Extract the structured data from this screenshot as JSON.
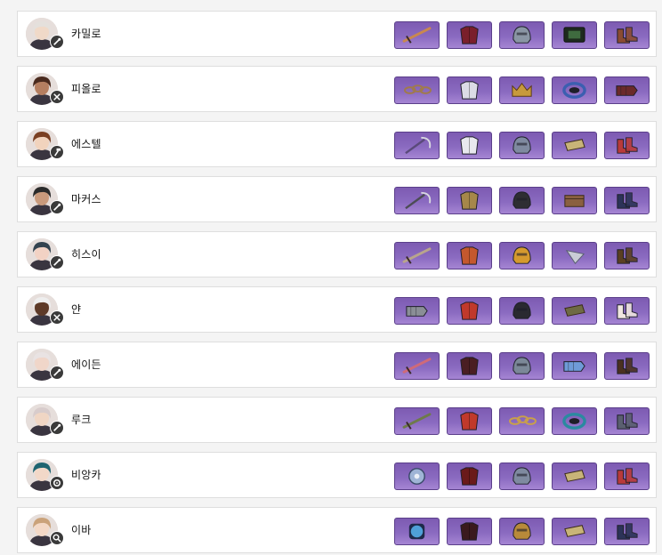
{
  "characters": [
    {
      "name": "카밀로",
      "role_icon": "wrench-icon",
      "hair": "#e4e0dc",
      "skin": "#f0d9c8",
      "items": [
        {
          "icon": "sword-icon",
          "color": "#c9884f"
        },
        {
          "icon": "armor-icon",
          "color": "#7a1f2b"
        },
        {
          "icon": "helmet-icon",
          "color": "#8a96a4"
        },
        {
          "icon": "chip-icon",
          "color": "#3f6b3f"
        },
        {
          "icon": "boots-icon",
          "color": "#8a4b32"
        }
      ]
    },
    {
      "name": "피올로",
      "role_icon": "crossed-tools-icon",
      "hair": "#4a2a1e",
      "skin": "#b57e60",
      "items": [
        {
          "icon": "chain-icon",
          "color": "#a07a4c"
        },
        {
          "icon": "armor-icon",
          "color": "#dcdce6"
        },
        {
          "icon": "crown-icon",
          "color": "#c79a3c"
        },
        {
          "icon": "ring-icon",
          "color": "#3b5fb0"
        },
        {
          "icon": "gauntlet-icon",
          "color": "#6a2a2a"
        }
      ]
    },
    {
      "name": "에스텔",
      "role_icon": "hammer-icon",
      "hair": "#7a3f22",
      "skin": "#f1d3bd",
      "items": [
        {
          "icon": "scythe-icon",
          "color": "#5a4a7a"
        },
        {
          "icon": "armor-icon",
          "color": "#e8e8ee"
        },
        {
          "icon": "helmet-icon",
          "color": "#7f8aa0"
        },
        {
          "icon": "bracer-icon",
          "color": "#c8b478"
        },
        {
          "icon": "boots-icon",
          "color": "#b83a3a"
        }
      ]
    },
    {
      "name": "마커스",
      "role_icon": "wrench-icon",
      "hair": "#2b2b2b",
      "skin": "#c99a7c",
      "items": [
        {
          "icon": "scythe-icon",
          "color": "#4c4c55"
        },
        {
          "icon": "armor-icon",
          "color": "#a6874a"
        },
        {
          "icon": "helmet-icon",
          "color": "#2e2e33"
        },
        {
          "icon": "box-icon",
          "color": "#8a6040"
        },
        {
          "icon": "boots-icon",
          "color": "#2c3358"
        }
      ]
    },
    {
      "name": "히스이",
      "role_icon": "wrench-icon",
      "hair": "#33434f",
      "skin": "#f2d2c4",
      "items": [
        {
          "icon": "sword-icon",
          "color": "#b9a58c"
        },
        {
          "icon": "armor-icon",
          "color": "#c4582e"
        },
        {
          "icon": "helmet-icon",
          "color": "#d59a2e"
        },
        {
          "icon": "shield-icon",
          "color": "#c9ccd6"
        },
        {
          "icon": "boots-icon",
          "color": "#5a3f22"
        }
      ]
    },
    {
      "name": "얀",
      "role_icon": "crossed-tools-icon",
      "hair": "#eeeeee",
      "skin": "#5e3a28",
      "items": [
        {
          "icon": "gauntlet-icon",
          "color": "#8a8e96"
        },
        {
          "icon": "armor-icon",
          "color": "#c0392b"
        },
        {
          "icon": "helmet-icon",
          "color": "#2a2a30"
        },
        {
          "icon": "bracer-icon",
          "color": "#6e6a44"
        },
        {
          "icon": "boots-icon",
          "color": "#efe6e0"
        }
      ]
    },
    {
      "name": "에이든",
      "role_icon": "wrench-icon",
      "hair": "#e9e3e3",
      "skin": "#f0d6c9",
      "items": [
        {
          "icon": "sword-icon",
          "color": "#d06a78"
        },
        {
          "icon": "armor-icon",
          "color": "#4a1e22"
        },
        {
          "icon": "helmet-icon",
          "color": "#7b8898"
        },
        {
          "icon": "gauntlet-icon",
          "color": "#6f9bd8"
        },
        {
          "icon": "boots-icon",
          "color": "#4a3020"
        }
      ]
    },
    {
      "name": "루크",
      "role_icon": "wrench-icon",
      "hair": "#d8cccc",
      "skin": "#f0d6c4",
      "items": [
        {
          "icon": "sword-icon",
          "color": "#6e7a4a"
        },
        {
          "icon": "armor-icon",
          "color": "#c0392b"
        },
        {
          "icon": "chain-icon",
          "color": "#c9a04a"
        },
        {
          "icon": "ring-icon",
          "color": "#2a8aa0"
        },
        {
          "icon": "boots-icon",
          "color": "#5a5f70"
        }
      ]
    },
    {
      "name": "비앙카",
      "role_icon": "gear-icon",
      "hair": "#1e6470",
      "skin": "#f2d8c8",
      "items": [
        {
          "icon": "disc-icon",
          "color": "#9fb4d6"
        },
        {
          "icon": "armor-icon",
          "color": "#6a1a1a"
        },
        {
          "icon": "helmet-icon",
          "color": "#7f8aa0"
        },
        {
          "icon": "bracer-icon",
          "color": "#c8b478"
        },
        {
          "icon": "boots-icon",
          "color": "#b83a3a"
        }
      ]
    },
    {
      "name": "이바",
      "role_icon": "search-icon",
      "hair": "#caa27a",
      "skin": "#f3d8c6",
      "items": [
        {
          "icon": "orb-icon",
          "color": "#4fa0d8"
        },
        {
          "icon": "armor-icon",
          "color": "#3a1a1e"
        },
        {
          "icon": "helmet-icon",
          "color": "#b88a3a"
        },
        {
          "icon": "bracer-icon",
          "color": "#c8b478"
        },
        {
          "icon": "boots-icon",
          "color": "#2c3358"
        }
      ]
    }
  ]
}
